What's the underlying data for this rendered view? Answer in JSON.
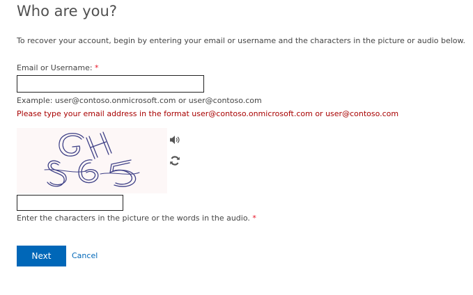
{
  "header": {
    "title": "Who are you?"
  },
  "intro": {
    "text": "To recover your account, begin by entering your email or username and the characters in the picture or audio below."
  },
  "email": {
    "label": "Email or Username:",
    "required_marker": "*",
    "value": "",
    "example": "Example: user@contoso.onmicrosoft.com or user@contoso.com",
    "error": "Please type your email address in the format user@contoso.onmicrosoft.com or user@contoso.com"
  },
  "captcha": {
    "image_icon": "captcha-image",
    "audio_icon": "speaker-icon",
    "refresh_icon": "refresh-icon",
    "value": "",
    "hint": "Enter the characters in the picture or the words in the audio.",
    "required_marker": "*"
  },
  "actions": {
    "next_label": "Next",
    "cancel_label": "Cancel"
  },
  "colors": {
    "accent": "#0067b8",
    "error": "#a80000",
    "required": "#e81123"
  }
}
